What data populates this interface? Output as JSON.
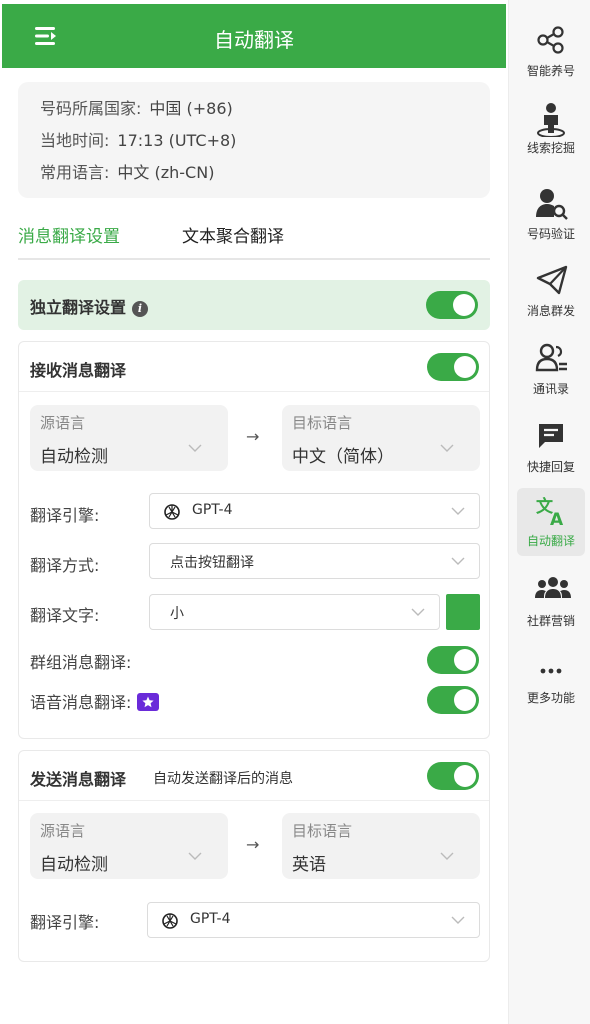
{
  "header": {
    "title": "自动翻译",
    "menu_icon": "collapse-menu-icon"
  },
  "info": {
    "country_label": "号码所属国家:",
    "country_value": "中国 (+86)",
    "time_label": "当地时间:",
    "time_value": "17:13 (UTC+8)",
    "lang_label": "常用语言:",
    "lang_value": "中文 (zh-CN)"
  },
  "tabs": [
    {
      "label": "消息翻译设置",
      "active": true
    },
    {
      "label": "文本聚合翻译",
      "active": false
    }
  ],
  "independent": {
    "label": "独立翻译设置",
    "info_icon": "i",
    "enabled": true
  },
  "receive": {
    "title": "接收消息翻译",
    "enabled": true,
    "source_caption": "源语言",
    "source_value": "自动检测",
    "target_caption": "目标语言",
    "target_value": "中文（简体）",
    "arrow": "→",
    "engine_label": "翻译引擎:",
    "engine_value": "GPT-4",
    "mode_label": "翻译方式:",
    "mode_value": "点击按钮翻译",
    "text_label": "翻译文字:",
    "text_value": "小",
    "text_color": "#3aaa47",
    "group_label": "群组消息翻译:",
    "group_enabled": true,
    "voice_label": "语音消息翻译:",
    "voice_enabled": true
  },
  "send": {
    "title": "发送消息翻译",
    "subtitle": "自动发送翻译后的消息",
    "enabled": true,
    "source_caption": "源语言",
    "source_value": "自动检测",
    "target_caption": "目标语言",
    "target_value": "英语",
    "arrow": "→",
    "engine_label": "翻译引擎:",
    "engine_value": "GPT-4"
  },
  "sidebar": {
    "items": [
      {
        "label": "智能养号",
        "icon": "share-icon"
      },
      {
        "label": "线索挖掘",
        "icon": "user-location-icon"
      },
      {
        "label": "号码验证",
        "icon": "user-search-icon"
      },
      {
        "label": "消息群发",
        "icon": "paper-plane-icon"
      },
      {
        "label": "通讯录",
        "icon": "contacts-icon"
      },
      {
        "label": "快捷回复",
        "icon": "chat-reply-icon"
      },
      {
        "label": "自动翻译",
        "icon": "translate-icon",
        "active": true
      },
      {
        "label": "社群营销",
        "icon": "group-icon"
      },
      {
        "label": "更多功能",
        "icon": "more-icon"
      }
    ]
  },
  "colors": {
    "accent": "#3aaa47",
    "header_bg": "#3aaa47",
    "section_bg": "#e2f2e4"
  }
}
